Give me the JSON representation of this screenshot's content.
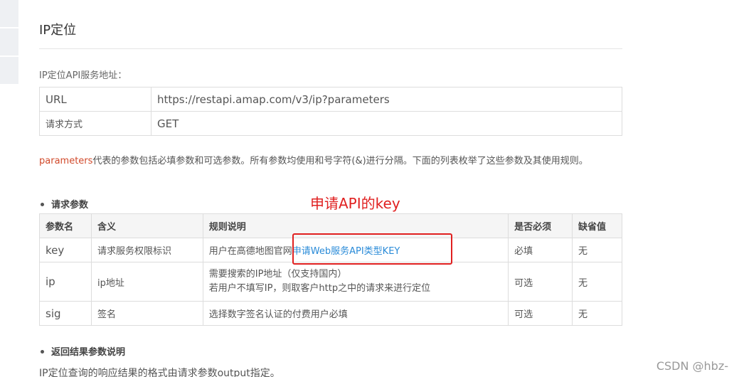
{
  "page": {
    "title": "IP定位",
    "service_label": "IP定位API服务地址："
  },
  "url_table": [
    {
      "key": "URL",
      "value": "https://restapi.amap.com/v3/ip?parameters"
    },
    {
      "key": "请求方式",
      "value": "GET"
    }
  ],
  "description": {
    "highlight": "parameters",
    "text": "代表的参数包括必填参数和可选参数。所有参数均使用和号字符(&)进行分隔。下面的列表枚举了这些参数及其使用规则。"
  },
  "section_request": "请求参数",
  "annotation": {
    "label": "申请API的key",
    "color": "#e02020"
  },
  "param_table": {
    "headers": [
      "参数名",
      "含义",
      "规则说明",
      "是否必须",
      "缺省值"
    ],
    "rows": [
      {
        "name": "key",
        "meaning": "请求服务权限标识",
        "rule_prefix": "用户在高德地图官网",
        "rule_link": "申请Web服务API类型KEY",
        "required": "必填",
        "default": "无"
      },
      {
        "name": "ip",
        "meaning": "ip地址",
        "rule_line1": "需要搜索的IP地址（仅支持国内）",
        "rule_line2": "若用户不填写IP，则取客户http之中的请求来进行定位",
        "required": "可选",
        "default": "无"
      },
      {
        "name": "sig",
        "meaning": "签名",
        "rule": "选择数字签名认证的付费用户必填",
        "required": "可选",
        "default": "无"
      }
    ]
  },
  "section_return": "返回结果参数说明",
  "footer_text": "IP定位查询的响应结果的格式由请求参数output指定。",
  "watermark": "CSDN @hbz-",
  "colors": {
    "link": "#2a8bd8",
    "highlight": "#d14a2b"
  }
}
